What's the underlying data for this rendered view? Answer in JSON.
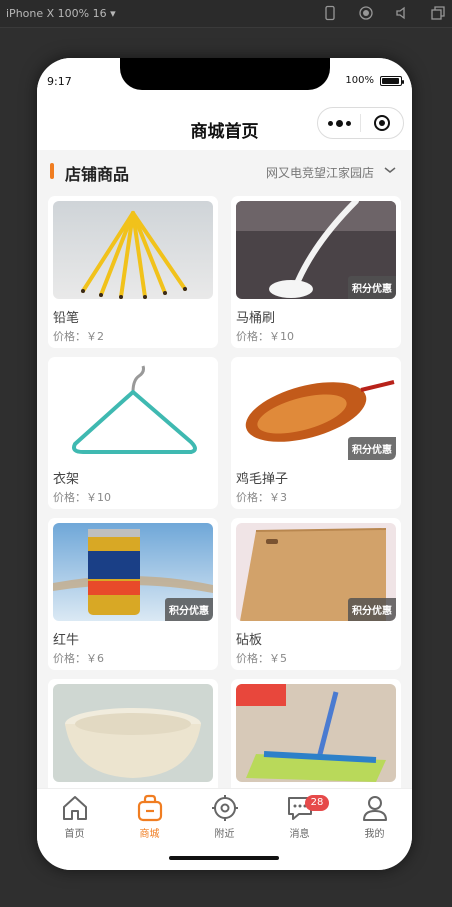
{
  "simulator": {
    "device_label": "iPhone X 100% 16 ▾"
  },
  "status_bar": {
    "time": "9:17",
    "battery": "100%"
  },
  "nav": {
    "title": "商城首页"
  },
  "section": {
    "label": "店铺商品",
    "store": "网又电竞望江家园店"
  },
  "products": [
    {
      "name": "铅笔",
      "price": "价格：￥2",
      "tag": ""
    },
    {
      "name": "马桶刷",
      "price": "价格：￥10",
      "tag": "积分优惠"
    },
    {
      "name": "衣架",
      "price": "价格：￥10",
      "tag": ""
    },
    {
      "name": "鸡毛掸子",
      "price": "价格：￥3",
      "tag": "积分优惠"
    },
    {
      "name": "红牛",
      "price": "价格：￥6",
      "tag": "积分优惠"
    },
    {
      "name": "砧板",
      "price": "价格：￥5",
      "tag": "积分优惠"
    },
    {
      "name": "",
      "price": "",
      "tag": ""
    },
    {
      "name": "",
      "price": "",
      "tag": ""
    }
  ],
  "tabbar": {
    "items": [
      {
        "label": "首页",
        "icon": "home-icon"
      },
      {
        "label": "商城",
        "icon": "shop-bag-icon"
      },
      {
        "label": "附近",
        "icon": "location-target-icon"
      },
      {
        "label": "消息",
        "icon": "message-icon",
        "badge": "28"
      },
      {
        "label": "我的",
        "icon": "user-icon"
      }
    ],
    "active_color": "#f07d21"
  },
  "colors": {
    "accent": "#f07d21",
    "badge": "#e64a4a"
  }
}
